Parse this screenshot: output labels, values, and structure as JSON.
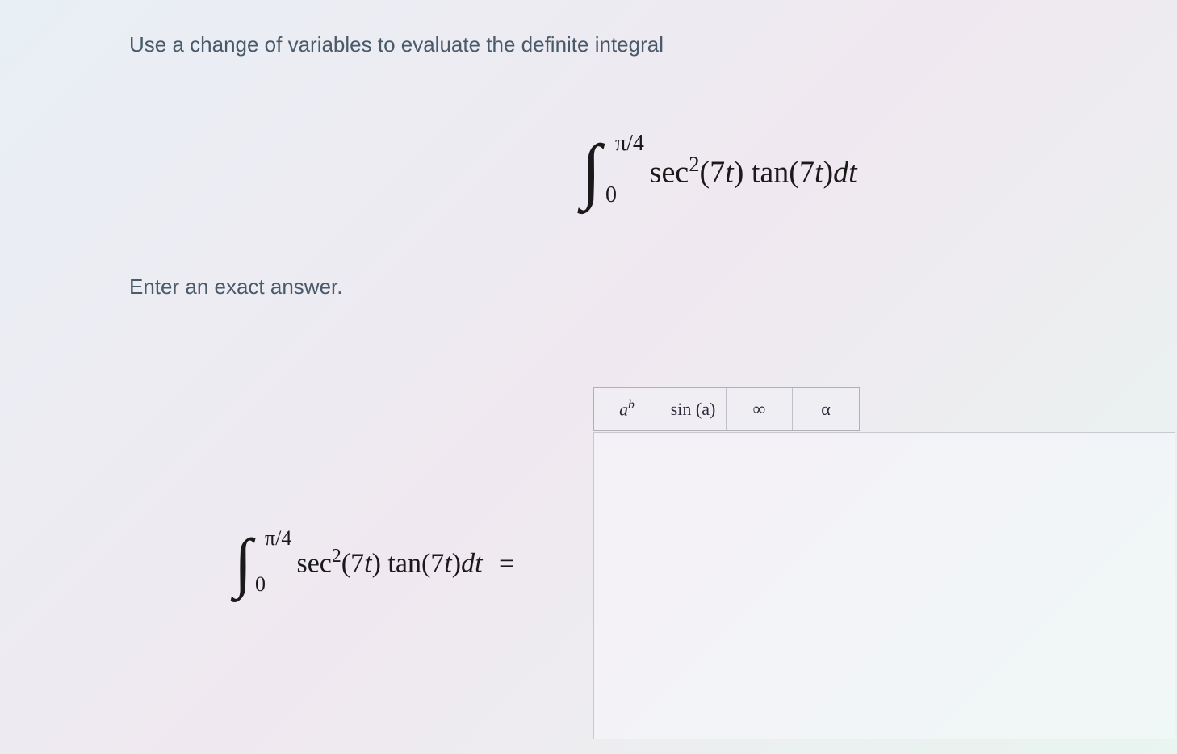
{
  "question": {
    "prompt": "Use a change of variables to evaluate the definite integral",
    "instruction": "Enter an exact answer."
  },
  "integral": {
    "upper_limit": "π/4",
    "lower_limit": "0",
    "integrand_sec": "sec",
    "integrand_exp": "2",
    "integrand_arg1": "(7",
    "integrand_var1": "t",
    "integrand_close1": ") ",
    "integrand_tan": "tan",
    "integrand_arg2": "(7",
    "integrand_var2": "t",
    "integrand_close2": ")",
    "integrand_dt_d": "d",
    "integrand_dt_t": "t"
  },
  "toolbar": {
    "exponent_a": "a",
    "exponent_b": "b",
    "trig": "sin (a)",
    "infinity": "∞",
    "alpha": "α"
  },
  "answer": {
    "upper_limit": "π/4",
    "lower_limit": "0",
    "equals": "="
  }
}
